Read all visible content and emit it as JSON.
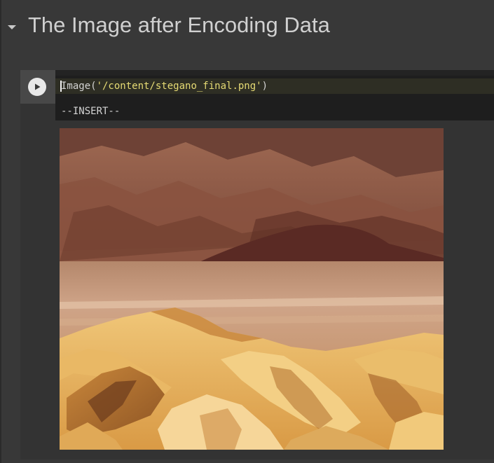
{
  "section": {
    "title": "The Image after Encoding Data",
    "toggle_icon": "caret-down-icon"
  },
  "cell": {
    "run_icon": "play-icon",
    "code": {
      "func": "Image(",
      "arg": "'/content/stegano_final.png'",
      "close": ")"
    },
    "mode": "--INSERT--"
  },
  "output": {
    "image_subject": "desert badlands landscape"
  },
  "colors": {
    "background": "#383838",
    "title": "#d0d0d0",
    "code_bg": "#1e1e1e",
    "string": "#e6db74"
  }
}
